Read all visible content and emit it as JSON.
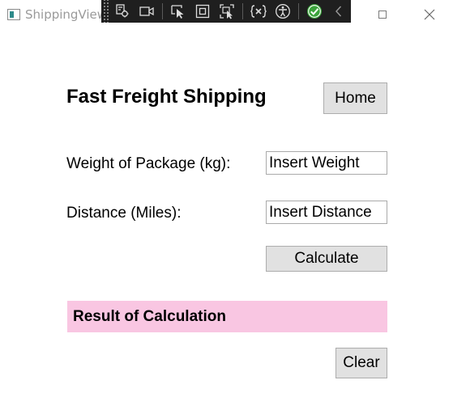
{
  "window": {
    "title": "ShippingView"
  },
  "debug_toolbar": {
    "tools": [
      {
        "icon": "live-visual-tree-icon"
      },
      {
        "icon": "video-camera-icon"
      },
      {
        "icon": "select-element-icon"
      },
      {
        "icon": "display-layout-adorners-icon"
      },
      {
        "icon": "track-focused-element-icon"
      },
      {
        "icon": "binding-failures-icon"
      },
      {
        "icon": "accessibility-icon"
      },
      {
        "icon": "hot-reload-check-icon"
      },
      {
        "icon": "collapse-chevron-icon"
      }
    ]
  },
  "header": {
    "title": "Fast Freight Shipping",
    "home_label": "Home"
  },
  "form": {
    "weight_label": "Weight of Package (kg):",
    "weight_placeholder": "Insert Weight",
    "weight_value": "",
    "distance_label": "Distance (Miles):",
    "distance_placeholder": "Insert Distance",
    "distance_value": "",
    "calculate_label": "Calculate"
  },
  "result": {
    "text": "Result of Calculation",
    "background_color": "#f9c6e2"
  },
  "footer": {
    "clear_label": "Clear"
  }
}
